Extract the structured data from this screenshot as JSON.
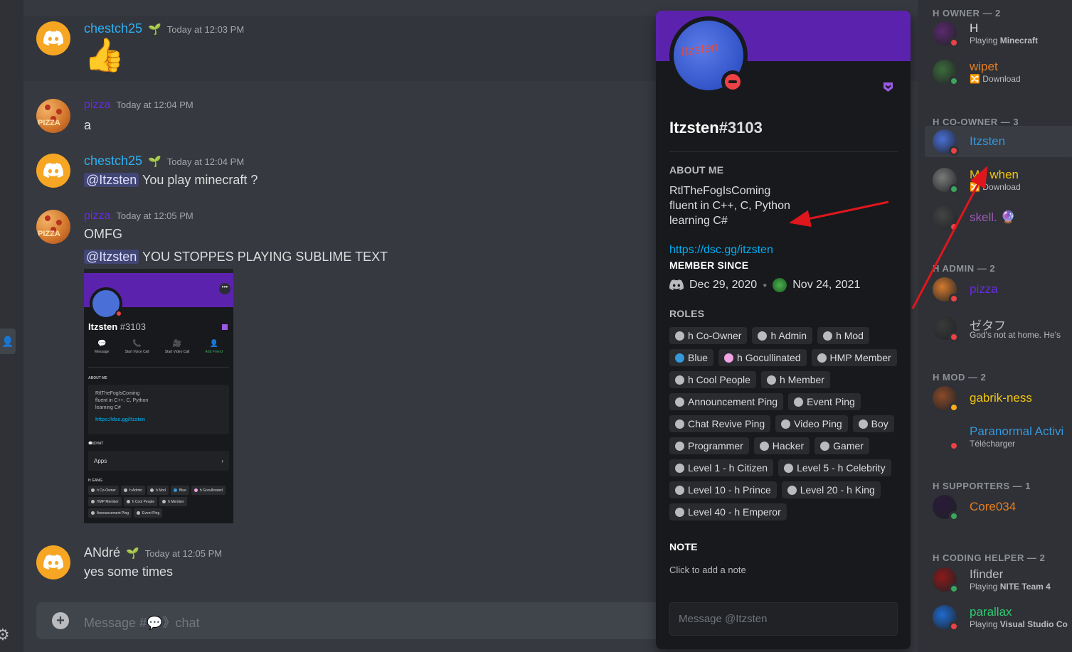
{
  "messages": [
    {
      "user": "chestch25",
      "time": "Today at 12:03 PM",
      "content": "👍"
    },
    {
      "user": "pizza",
      "time": "Today at 12:04 PM",
      "content": "a"
    },
    {
      "user": "chestch25",
      "time": "Today at 12:04 PM",
      "mention": "@Itzsten",
      "content": "You play minecraft ?"
    },
    {
      "user": "pizza",
      "time": "Today at 12:05 PM",
      "content": "OMFG",
      "mention": "@Itzsten",
      "content2": "YOU STOPPES PLAYING SUBLIME TEXT"
    },
    {
      "user": "ANdré",
      "time": "Today at 12:05 PM",
      "content": "yes some times"
    }
  ],
  "avatar_text": {
    "pizza": "PIZZA"
  },
  "embed": {
    "name": "Itzsten",
    "disc": "#3103",
    "actions": [
      "Message",
      "Start Voice Call",
      "Start Video Call",
      "Add Friend"
    ],
    "about_header": "ABOUT ME",
    "about": [
      "RtlTheFogIsComing",
      "fluent in C++, C, Python",
      "learning C#"
    ],
    "link": "https://dsc.gg/itzsten",
    "chat_header": "💬|CHAT",
    "apps": "Apps",
    "roles_header": "H GANG",
    "roles": [
      "h Co-Owner",
      "h Admin",
      "h Mod",
      "Blue",
      "h Gocullinated",
      "HMP Member",
      "h Cool People",
      "h Member",
      "Announcement Ping",
      "Event Ping"
    ]
  },
  "input": {
    "placeholder": "Message #💬》chat"
  },
  "profile": {
    "name": "Itzsten",
    "disc": "#3103",
    "avatar_text": "Itzsten",
    "about_header": "ABOUT ME",
    "about": [
      "RtlTheFogIsComing",
      "fluent in C++, C, Python",
      "learning C#"
    ],
    "link": "https://dsc.gg/itzsten",
    "member_since_header": "MEMBER SINCE",
    "discord_since": "Dec 29, 2020",
    "server_since": "Nov 24, 2021",
    "roles_header": "ROLES",
    "roles": [
      {
        "name": "h Co-Owner",
        "color": "#b9bbbe"
      },
      {
        "name": "h Admin",
        "color": "#b9bbbe"
      },
      {
        "name": "h Mod",
        "color": "#b9bbbe"
      },
      {
        "name": "Blue",
        "color": "#3498db"
      },
      {
        "name": "h Gocullinated",
        "color": "#f1a3e4"
      },
      {
        "name": "HMP Member",
        "color": "#b9bbbe"
      },
      {
        "name": "h Cool People",
        "color": "#b9bbbe"
      },
      {
        "name": "h Member",
        "color": "#b9bbbe"
      },
      {
        "name": "Announcement Ping",
        "color": "#b9bbbe"
      },
      {
        "name": "Event Ping",
        "color": "#b9bbbe"
      },
      {
        "name": "Chat Revive Ping",
        "color": "#b9bbbe"
      },
      {
        "name": "Video Ping",
        "color": "#b9bbbe"
      },
      {
        "name": "Boy",
        "color": "#b9bbbe"
      },
      {
        "name": "Programmer",
        "color": "#b9bbbe"
      },
      {
        "name": "Hacker",
        "color": "#b9bbbe"
      },
      {
        "name": "Gamer",
        "color": "#b9bbbe"
      },
      {
        "name": "Level 1 - h Citizen",
        "color": "#b9bbbe"
      },
      {
        "name": "Level 5 - h Celebrity",
        "color": "#b9bbbe"
      },
      {
        "name": "Level 10 - h Prince",
        "color": "#b9bbbe"
      },
      {
        "name": "Level 20 - h King",
        "color": "#b9bbbe"
      },
      {
        "name": "Level 40 - h Emperor",
        "color": "#b9bbbe"
      }
    ],
    "note_header": "NOTE",
    "note_placeholder": "Click to add a note",
    "message_placeholder": "Message @Itzsten"
  },
  "members": {
    "groups": [
      {
        "title": "H OWNER — 2"
      },
      {
        "title": "H CO-OWNER — 3"
      },
      {
        "title": "H ADMIN — 2"
      },
      {
        "title": "H MOD — 2"
      },
      {
        "title": "H SUPPORTERS — 1"
      },
      {
        "title": "H CODING HELPER — 2"
      }
    ],
    "list": [
      {
        "name": "H",
        "sub": "Playing ",
        "sub_b": "Minecraft",
        "color": "#dcddde",
        "status": "dnd"
      },
      {
        "name": "wipet",
        "sub": "🔀 Download",
        "color": "#e67e22",
        "status": "on"
      },
      {
        "name": "Itzsten",
        "color": "#3498db",
        "status": "dnd"
      },
      {
        "name": "Me when",
        "sub": "🔀 Download",
        "color": "#f1c40f",
        "status": "on"
      },
      {
        "name": "skell. 🔮",
        "color": "#9b59b6",
        "status": "dnd"
      },
      {
        "name": "pizza",
        "color": "#6a2ae8",
        "status": "dnd"
      },
      {
        "name": "ゼタフ",
        "sub": "God's not at home. He's",
        "color": "#b9bbbe",
        "status": "dnd"
      },
      {
        "name": "gabrik-ness",
        "color": "#f1c40f",
        "status": "idle"
      },
      {
        "name": "Paranormal Activi",
        "sub": "Télécharger",
        "color": "#3498db",
        "status": "dnd"
      },
      {
        "name": "Core034",
        "color": "#e67e22",
        "status": "on"
      },
      {
        "name": "Ifinder",
        "sub": "Playing ",
        "sub_b": "NITE Team 4",
        "color": "#b9bbbe",
        "status": "on"
      },
      {
        "name": "parallax",
        "sub": "Playing ",
        "sub_b": "Visual Studio Co",
        "color": "#2ecc71",
        "status": "dnd"
      }
    ]
  },
  "colors": {
    "background": "#36393f",
    "sidebar": "#2f3136",
    "popout": "#18191c",
    "banner": "#5b23ad",
    "annotation_arrow": "#e0161d"
  }
}
